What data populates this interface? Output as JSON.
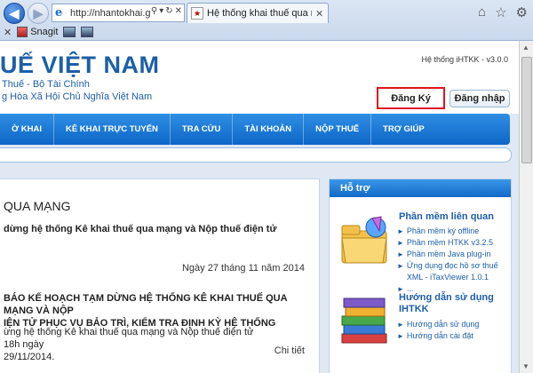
{
  "browser": {
    "url": "http://nhantokhai.g",
    "tab_title": "Hệ thống khai thuế qua mạng",
    "toolbar_snagit": "Snagit"
  },
  "header": {
    "brand": "UẾ VIỆT NAM",
    "sub1": "Thuế - Bộ Tài Chính",
    "sub2": "g Hòa Xã Hội Chủ Nghĩa Việt Nam",
    "version": "Hệ thống iHTKK - v3.0.0",
    "register_label": "Đăng Ký",
    "login_label": "Đăng nhập"
  },
  "menu": [
    "Ờ KHAI",
    "KÊ KHAI TRỰC TUYẾN",
    "TRA CỨU",
    "TÀI KHOẢN",
    "NỘP THUẾ",
    "TRỢ GIÚP"
  ],
  "main": {
    "heading": "QUA MẠNG",
    "news_title": "dừng hệ thống Kê khai thuế qua mạng và Nộp thuế điện tử",
    "date": "Ngày 27 tháng 11 năm 2014",
    "notice_line1": "BÁO KẾ HOẠCH TẠM DỪNG HỆ THỐNG KÊ KHAI THUẾ QUA MẠNG VÀ NỘP",
    "notice_line2": "IỆN TỬ PHỤC VỤ BẢO TRÌ, KIỂM TRA ĐỊNH KỲ HỆ THỐNG",
    "body_line1": "ừng hệ thống Kê khai thuế qua mạng và Nộp thuế điện tử 18h ngày",
    "body_line2": "29/11/2014.",
    "detail": "Chi tiết"
  },
  "sidebar": {
    "heading": "Hỗ trợ",
    "section1_title": "Phần mềm liên quan",
    "section1_links": [
      "Phần mềm ký offline",
      "Phần mềm HTKK v3.2.5",
      "Phần mềm Java plug-in",
      "Ứng dụng đọc hồ sơ thuế XML - iTaxViewer 1.0.1",
      "..."
    ],
    "section2_title": "Hướng dẫn sử dụng IHTKK",
    "section2_links": [
      "Hướng dẫn sử dụng",
      "Hướng dẫn cài đặt"
    ]
  }
}
